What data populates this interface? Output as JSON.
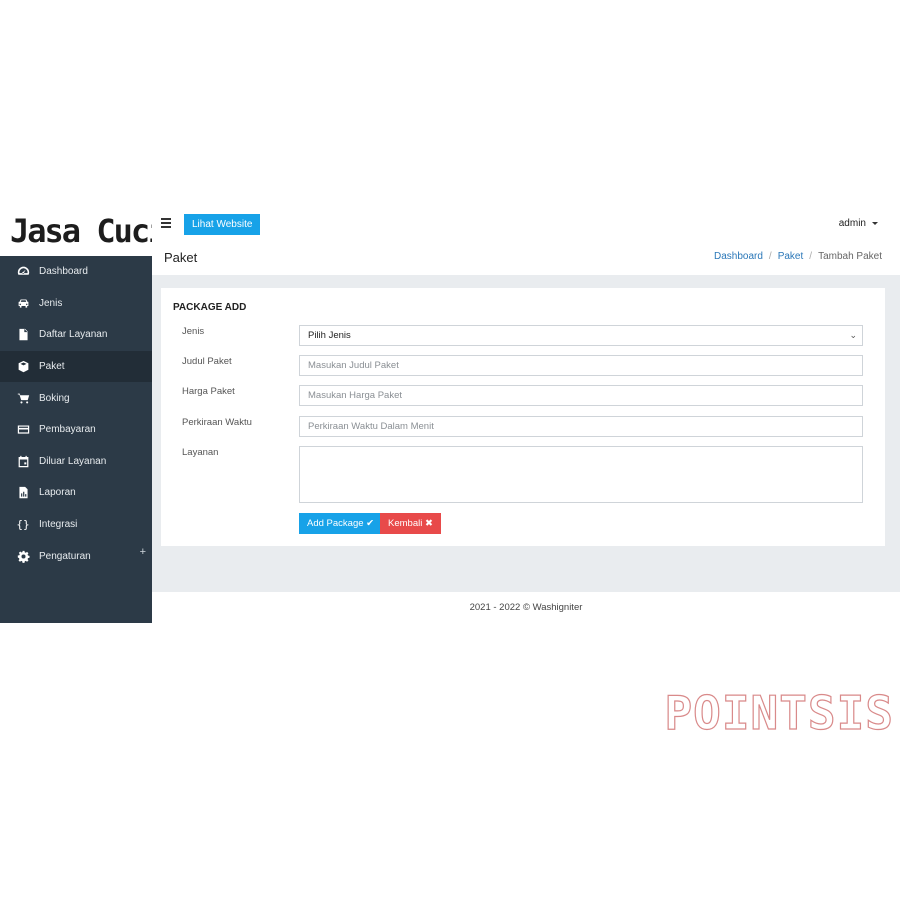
{
  "brand": {
    "name": "Jasa Cuci"
  },
  "topbar": {
    "website_button": "Lihat Website",
    "user": "admin"
  },
  "sidebar": {
    "items": [
      {
        "label": "Dashboard",
        "icon": "speedometer-icon"
      },
      {
        "label": "Jenis",
        "icon": "car-icon"
      },
      {
        "label": "Daftar Layanan",
        "icon": "file-icon"
      },
      {
        "label": "Paket",
        "icon": "box-icon",
        "active": true
      },
      {
        "label": "Boking",
        "icon": "cart-icon"
      },
      {
        "label": "Pembayaran",
        "icon": "credit-card-icon"
      },
      {
        "label": "Diluar Layanan",
        "icon": "calendar-icon"
      },
      {
        "label": "Laporan",
        "icon": "report-icon"
      },
      {
        "label": "Integrasi",
        "icon": "braces-icon"
      },
      {
        "label": "Pengaturan",
        "icon": "gear-icon",
        "expand": "+"
      }
    ]
  },
  "header": {
    "title": "Paket",
    "breadcrumb": [
      "Dashboard",
      "Paket",
      "Tambah Paket"
    ],
    "breadcrumb_sep": "/"
  },
  "form": {
    "title": "PACKAGE ADD",
    "jenis": {
      "label": "Jenis",
      "selected": "Pilih Jenis"
    },
    "judul": {
      "label": "Judul Paket",
      "placeholder": "Masukan Judul Paket"
    },
    "harga": {
      "label": "Harga Paket",
      "placeholder": "Masukan Harga Paket"
    },
    "waktu": {
      "label": "Perkiraan Waktu",
      "placeholder": "Perkiraan Waktu Dalam Menit"
    },
    "layanan": {
      "label": "Layanan"
    },
    "add_button": "Add Package ✔",
    "back_button": "Kembali ✖"
  },
  "footer": {
    "text": "2021 - 2022 © Washigniter"
  },
  "watermark": {
    "text": "POINTSIS"
  },
  "colors": {
    "sidebar": "#2c3a47",
    "primary": "#17a2e8",
    "danger": "#e84a4a",
    "link": "#2a77b8"
  }
}
